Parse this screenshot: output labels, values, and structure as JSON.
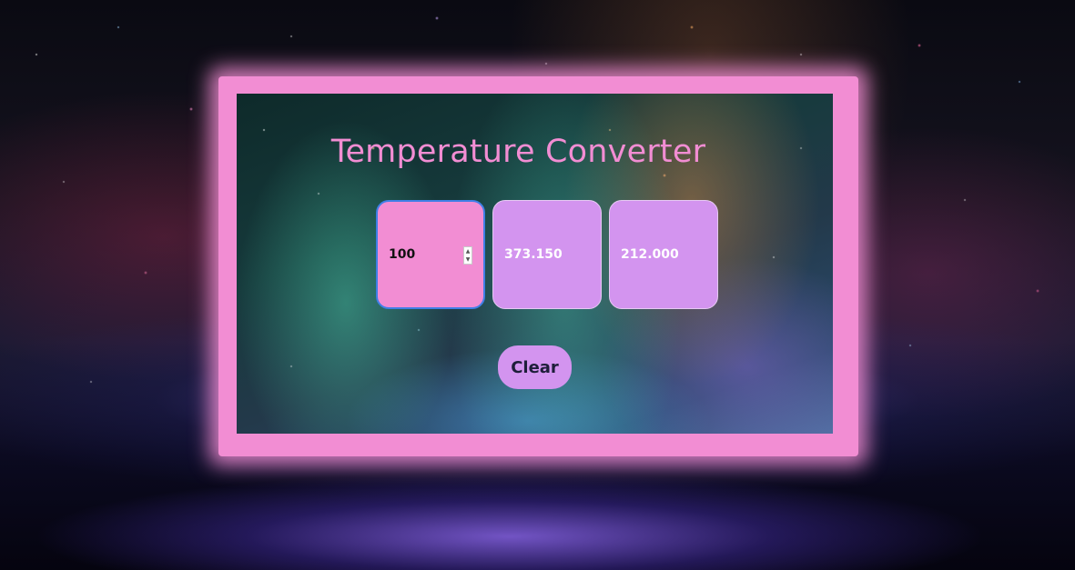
{
  "converter": {
    "title": "Temperature Converter",
    "celsius_value": "100",
    "kelvin_value": "373.150",
    "fahrenheit_value": "212.000",
    "clear_label": "Clear"
  },
  "icons": {
    "spinner_up": "spinner-up-icon",
    "spinner_down": "spinner-down-icon"
  },
  "colors": {
    "frame": "#f28dd3",
    "title": "#f28dd3",
    "celsius_box": "#f28dd3",
    "converted_box": "#d394ef",
    "focus_border": "#3f7fe6",
    "button": "#d394ef",
    "button_text": "#1e1e3a"
  }
}
